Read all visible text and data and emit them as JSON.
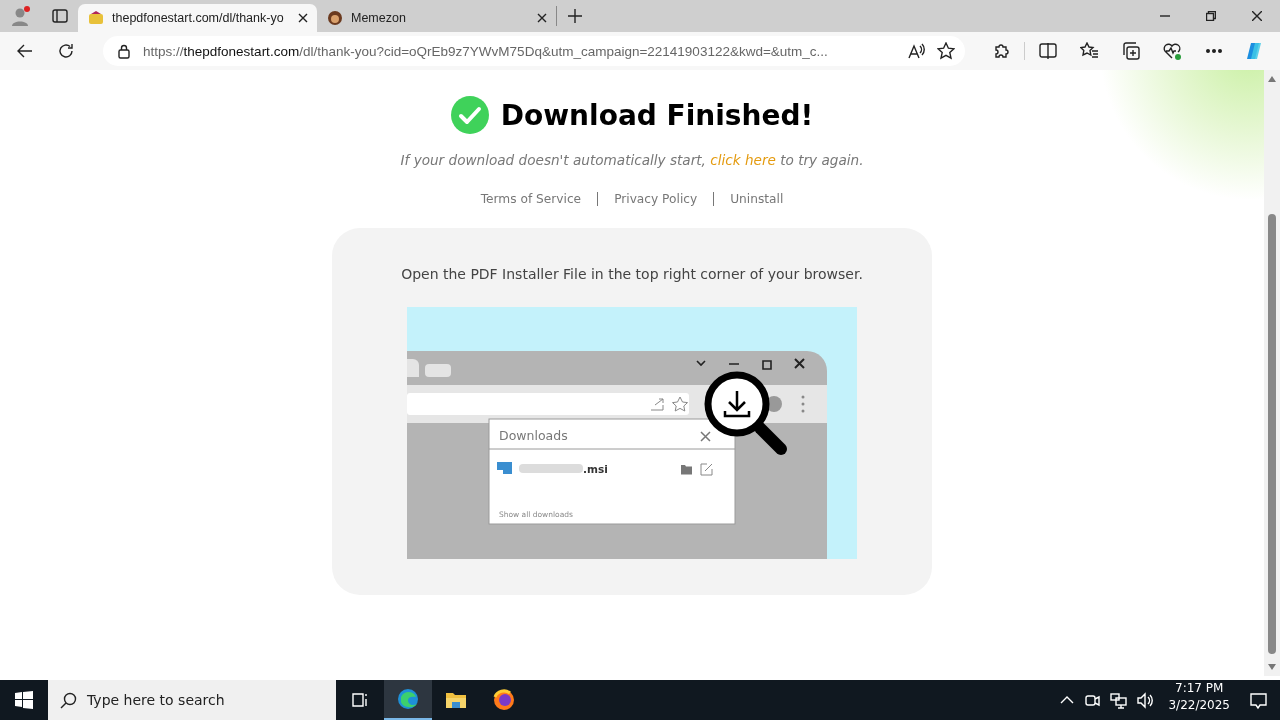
{
  "browser": {
    "tabs": [
      {
        "title": "thepdfonestart.com/dl/thank-yo",
        "selected": true,
        "kind": "pdf"
      },
      {
        "title": "Memezon",
        "selected": false,
        "kind": "avatar"
      }
    ],
    "address": {
      "scheme": "https://",
      "host": "thepdfonestart.com",
      "path": "/dl/thank-you?cid=oQrEb9z7YWvM75Dq&utm_campaign=22141903122&kwd=&utm_c..."
    }
  },
  "page": {
    "heading": "Download Finished!",
    "subtitle": "If your download doesn't automatically start, ",
    "retry_link": "click here",
    "subtitle_end": " to try again.",
    "links": [
      "Terms of Service",
      "Privacy Policy",
      "Uninstall"
    ],
    "instruction": "Open the PDF Installer File in the top right corner of your browser.",
    "illustration": {
      "panel_title": "Downloads",
      "file_extension": ".msi",
      "footer_link": "Show all downloads"
    }
  },
  "taskbar": {
    "search_placeholder": "Type here to search",
    "apps": [
      {
        "kind": "edge",
        "selected": true
      },
      {
        "kind": "folder",
        "selected": false
      },
      {
        "kind": "firefox",
        "selected": false
      }
    ],
    "time": "7:17 PM",
    "date": "3/22/2025"
  }
}
